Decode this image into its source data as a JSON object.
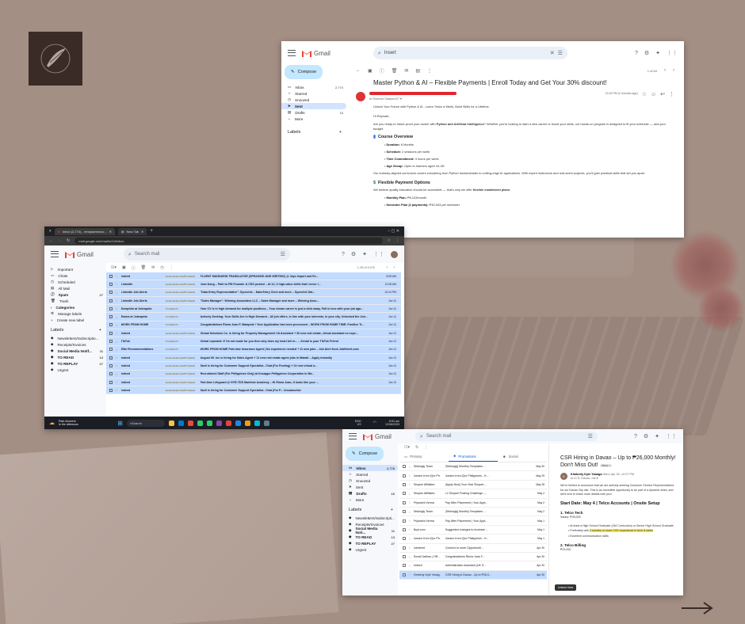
{
  "w1": {
    "brand": "Gmail",
    "search_value": "Insert",
    "compose": "Compose",
    "nav": [
      {
        "label": "Inbox",
        "count": "2,774"
      },
      {
        "label": "Starred",
        "count": ""
      },
      {
        "label": "Snoozed",
        "count": ""
      },
      {
        "label": "Sent",
        "count": ""
      },
      {
        "label": "Drafts",
        "count": "15"
      },
      {
        "label": "More",
        "count": ""
      }
    ],
    "labels_heading": "Labels",
    "pager": "1 of 64",
    "subject": "Master Python & AI – Flexible Payments | Enroll Today and Get Your 30% discount!",
    "to_me": "to Rommel Salamro27 ▾",
    "time": "11:00 PM (2 minutes ago)",
    "intro": "Unlock Your Future with Python & AI - Learn Twice a Week, Build Skills for a Lifetime.",
    "greeting": "Hi Reymart,",
    "para1_a": "Are you ready to future-proof your career with ",
    "para1_b": "Python and Artificial Intelligence",
    "para1_c": "? Whether you're looking to start a new career or boost your skills, our hands-on program is designed to fit your schedule — and your budget.",
    "h_course": "Course Overview",
    "bullets": [
      {
        "k": "Duration:",
        "v": " 6 Months"
      },
      {
        "k": "Schedule:",
        "v": " 2 sessions per week"
      },
      {
        "k": "Time Commitment:",
        "v": " 4 hours per week"
      },
      {
        "k": "Age Group:",
        "v": " Open to learners aged 16–55"
      }
    ],
    "para2": "Our industry-aligned curriculum covers everything from Python fundamentals to cutting-edge AI applications. With expert instructors and real-world projects, you'll gain practical skills that set you apart.",
    "h_payment": "Flexible Payment Options",
    "para3_a": "We believe quality education should be accessible — that's why we offer ",
    "para3_b": "flexible installment plans",
    "para3_c": ":",
    "pay_k": "Monthly Plan:",
    "pay_v": " ₱8,143/month",
    "pay2_k": "Semester Plan (2 payments):",
    "pay2_v": " ₱30,943 per semester"
  },
  "w2": {
    "tab1": "Inbox (2,774) - reneplamenco...",
    "tab2": "New Tab",
    "url": "mail.google.com/mail/u/1/#inbox",
    "brand": "Gmail",
    "search_placeholder": "Search mail",
    "pager": "1–50 of 3,476",
    "nav": [
      {
        "label": "Important",
        "count": ""
      },
      {
        "label": "Chats",
        "count": ""
      },
      {
        "label": "Scheduled",
        "count": ""
      },
      {
        "label": "All Mail",
        "count": ""
      },
      {
        "label": "Spam",
        "count": "27"
      },
      {
        "label": "Trash",
        "count": ""
      },
      {
        "label": "Categories",
        "count": ""
      },
      {
        "label": "Manage labels",
        "count": ""
      },
      {
        "label": "Create new label",
        "count": ""
      }
    ],
    "labels_heading": "Labels",
    "labels": [
      {
        "label": "Newsletters/Subscriptio...",
        "count": ""
      },
      {
        "label": "Receipts/Invoices",
        "count": ""
      },
      {
        "label": "Social Media Notif...",
        "count": "11"
      },
      {
        "label": "TO READ",
        "count": "13"
      },
      {
        "label": "TO REPLAY",
        "count": "27"
      },
      {
        "label": "Urgent",
        "count": ""
      }
    ],
    "rows": [
      {
        "from": "Indeed",
        "l1": "Social Media Notificati...",
        "l2": "TO READ",
        "subj": "FLUENT MANDARIN TRANSLATOR (SPEAKING AND WRITING) @ Jays Import and Ex...",
        "when": "8:05 AM"
      },
      {
        "from": "LinkedIn",
        "l1": "Social Media Notificati...",
        "l2": "TO READ",
        "subj": "Jean Kang – Path to PM Founder & CEO posted – At 12, 3 high-value skills that I never l...",
        "when": "12:06 AM"
      },
      {
        "from": "LinkedIn Job Alerts",
        "l1": "Social Media Notificati...",
        "l2": "TO READ",
        "subj": "\"Data Entry Representative\": Synechie – Data Entry Clerk and more – Synechie Dat...",
        "when": "10:24 PM"
      },
      {
        "from": "LinkedIn Job Alerts",
        "l1": "Social Media Notificati...",
        "l2": "TO READ",
        "subj": "\"Sales Manager\": Winning Associates LLC – Sales Manager and more – Winning Asso...",
        "when": "Jun 11"
      },
      {
        "from": "Seraphim at Jobrapido",
        "l1": "TO REPLAY",
        "l2": "",
        "subj": "Your CV is in high demand for multiple positions – Your dream career is just a click away. Fall in love with your job aga...",
        "when": "Jun 11"
      },
      {
        "from": "Emma at Jobrapido",
        "l1": "TO REPLAY",
        "l2": "",
        "subj": "Actively Seeking: Your Skills Are in High Demand – All job offers, in line with your interests, in your city. Unlocked the Job...",
        "when": "Jun 11"
      },
      {
        "from": "WORK FROM HOME",
        "l1": "TO REPLAY",
        "l2": "",
        "subj": "Congratulations Rinna Joan F. Malapote ! Your Application has been processed – WORK FROM HOME TIME: Positive Tr...",
        "when": "Jun 11"
      },
      {
        "from": "Indeed",
        "l1": "Social Media Notificati...",
        "l2": "TO READ",
        "subj": "Global Solutions Co. is hiring for Property Management VA Assistant + 30 new real estate, virtual assistant no expe...",
        "when": "Jun 11"
      },
      {
        "from": "TikTok",
        "l1": "TO REPLAY",
        "l2": "",
        "subj": "Xenial reposted: If I'm not made for you then why does my heart tell m... – Xenial is your TikTok Friend",
        "when": "Jun 11"
      },
      {
        "from": "Elite Recommendations",
        "l1": "TO REPLAY",
        "l2": "",
        "subj": "WORK FROM HOME Part-time Insurance Agent | No experience needed + 11 new jobs – Job Alert from JobStreet.com",
        "when": "Jun 11"
      },
      {
        "from": "Indeed",
        "l1": "Social Media Notificati...",
        "l2": "TO READ",
        "subj": "August 99. Inc is hiring for Sales Agent + 11 new real estate agent jobs in Makati – Apply instantly",
        "when": "Jun 11"
      },
      {
        "from": "Indeed",
        "l1": "Social Media Notificati...",
        "l2": "TO READ",
        "subj": "Savii is hiring for Customer Support Specialist– Chat (For Posting) + 22 new virtual a...",
        "when": "Jun 11"
      },
      {
        "from": "Indeed",
        "l1": "Social Media Notificati...",
        "l2": "TO READ",
        "subj": "Recruitment Staff (For Philippines Only) at Kosappo Philippines Corporation in Ma...",
        "when": "Jun 11"
      },
      {
        "from": "Indeed",
        "l1": "Social Media Notificati...",
        "l2": "TO READ",
        "subj": "Part-time Lifeguard @ HYR-TDS Maritime Academy – Hi Rinna Joan, It looks like your ...",
        "when": "Jun 11"
      },
      {
        "from": "Indeed",
        "l1": "Social Media Notificati...",
        "l2": "TO READ",
        "subj": "Savii is hiring for Customer Support Specialist– Chat (For P... Unsubscribe",
        "when": ""
      }
    ],
    "weather": "Rain showers",
    "weather2": "In the afternoon",
    "taskbar_search": "Search",
    "tray_lang": "ENG",
    "tray_region": "US",
    "clock": "8:51 am",
    "date": "12/06/2025"
  },
  "w3": {
    "brand": "Gmail",
    "search_placeholder": "Search mail",
    "compose": "Compose",
    "nav": [
      {
        "label": "Inbox",
        "count": "2,778"
      },
      {
        "label": "Starred",
        "count": ""
      },
      {
        "label": "Snoozed",
        "count": ""
      },
      {
        "label": "Sent",
        "count": ""
      },
      {
        "label": "Drafts",
        "count": "16"
      },
      {
        "label": "More",
        "count": ""
      }
    ],
    "labels_heading": "Labels",
    "labels": [
      {
        "label": "Newsletters/Subscripti...",
        "count": ""
      },
      {
        "label": "Receipts/Invoices",
        "count": ""
      },
      {
        "label": "Social Media Noti...",
        "count": "11"
      },
      {
        "label": "TO READ",
        "count": "13"
      },
      {
        "label": "TO REPLAY",
        "count": "27"
      },
      {
        "label": "Urgent",
        "count": ""
      }
    ],
    "tabs": [
      "Primary",
      "Promotions",
      "Social"
    ],
    "rows": [
      {
        "from": "Strikingly Team",
        "subj": "[Strikingly] Monthly Templates ...",
        "when": "May 30"
      },
      {
        "from": "Joeann from iQor Ph.",
        "subj": "Joeann from iQor Philippines - H...",
        "when": "May 29"
      },
      {
        "from": "Shopee Affiliates .",
        "subj": "[Apply Now] Your Viral Shopee ...",
        "when": "May 28"
      },
      {
        "from": "Shopee Affiliates .",
        "subj": "L2 Shopee Posting Challenge -...",
        "when": "May 2"
      },
      {
        "from": "Priyanshi Verma",
        "subj": "Pay After Placement | Your Appl...",
        "when": "May 2"
      },
      {
        "from": "Strikingly Team",
        "subj": "[Strikingly] Monthly Templates ...",
        "when": "May 2"
      },
      {
        "from": "Priyanshi Verma",
        "subj": "Pay After Placement | Your Appl...",
        "when": "May 1"
      },
      {
        "from": "Boyt.com",
        "subj": "Suggested changes to increase ...",
        "when": "May 1"
      },
      {
        "from": "Joeann from iQor Ph.",
        "subj": "Joeann from iQor Philippines - H...",
        "when": "May 1"
      },
      {
        "from": "Jobstreet",
        "subj": "Connect to more Opportuniti...",
        "when": "Apr 30"
      },
      {
        "from": "Sonali Jadhav | HR...",
        "subj": "Congratulations Rinna Joan F...",
        "when": "Apr 30"
      },
      {
        "from": "Indeed",
        "subj": "Administration Assistant (UK S...",
        "when": "Apr 30"
      },
      {
        "from": "Kimberly Kyle Yanag.",
        "subj": "CSR Hiring in Davao - Up to ₱26,0...",
        "when": "Apr 30"
      }
    ],
    "reader_title": "CSR Hiring in Davao – Up to ₱26,000 Monthly! Don't Miss Out!",
    "reader_badge": "Inbox ×",
    "sender_name": "Kimberly Kyle Yanago",
    "sender_meta": "Wed, Apr 30, 12:07 PM",
    "to_me": "to ICTL Davao, me ▾",
    "r_para": "We're thrilled to announce that we are actively seeking Customer Service Representatives for our Davao City site. This is an incredible opportunity to be part of a dynamic team, and we'd love to share more details with you!",
    "r_h1": "Start Date: May 4 | Telco Accounts | Onsite Setup",
    "r_h2": "1. Telco Tech",
    "r_salary": "Salary: ₱26,000",
    "r_b1": "At least a High School Graduate (Old Curriculum) or Senior High School Graduate",
    "r_b2_a": "Preferably with ",
    "r_b2_b": "2 months or more CCE experience in tech & sales",
    "r_b3": "Excellent communication skills",
    "r_h3": "2. Telco Billing",
    "r_salary2": "₱23,000",
    "tooltip": "Unlock Now"
  },
  "colors": {
    "background": "#a48f85",
    "selected_row": "#c2dbff",
    "compose": "#c2e7ff",
    "accent": "#0b57d0"
  }
}
